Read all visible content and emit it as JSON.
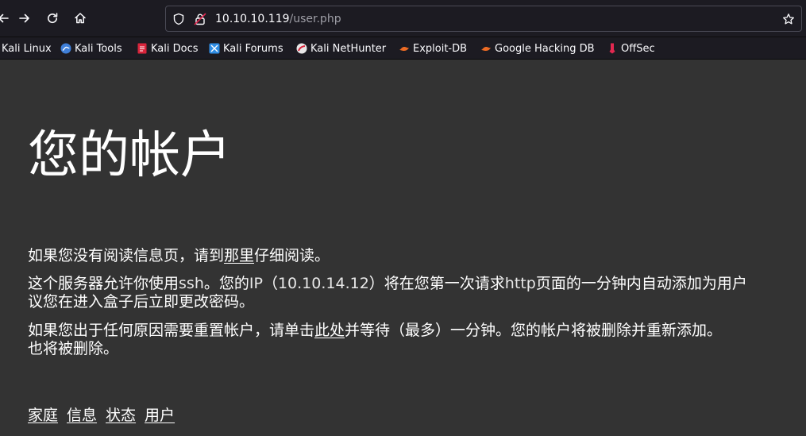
{
  "browser": {
    "url_host": "10.10.10.119",
    "url_path": "/user.php",
    "nav_icons": [
      "back-arrow-icon",
      "forward-arrow-icon",
      "reload-icon",
      "home-icon"
    ],
    "urlbar_icons": [
      "shield-icon",
      "insecure-lock-icon",
      "star-icon"
    ]
  },
  "bookmarks": [
    {
      "label": "Kali Linux",
      "icon": "kali-linux-icon"
    },
    {
      "label": "Kali Tools",
      "icon": "kali-tools-icon"
    },
    {
      "label": "Kali Docs",
      "icon": "kali-docs-icon"
    },
    {
      "label": "Kali Forums",
      "icon": "kali-forums-icon"
    },
    {
      "label": "Kali NetHunter",
      "icon": "kali-nethunter-icon"
    },
    {
      "label": "Exploit-DB",
      "icon": "exploit-db-icon"
    },
    {
      "label": "Google Hacking DB",
      "icon": "google-hacking-db-icon"
    },
    {
      "label": "OffSec",
      "icon": "offsec-icon"
    }
  ],
  "page": {
    "title": "您的帐户",
    "para1": {
      "before": "如果您没有阅读信息页，请到",
      "link": "那里",
      "after": "仔细阅读。"
    },
    "para2": {
      "seg1": "这个服务器允许你使用",
      "ssh": "ssh",
      "seg2": "。您的",
      "ip_label": "IP",
      "seg3": "（",
      "ip": "10.10.14.12",
      "seg4": "）将在您第一次请求",
      "http": "http",
      "seg5": "页面的一分钟内自动添加为用户",
      "line2": "议您在进入盒子后立即更改密码。"
    },
    "para3": {
      "before": "如果您出于任何原因需要重置帐户，请单击",
      "link": "此处",
      "after": "并等待（最多）一分钟。您的帐户将被删除并重新添加。",
      "line2": "也将被删除。"
    },
    "footer_links": [
      "家庭",
      "信息",
      "状态",
      "用户"
    ]
  },
  "colors": {
    "toolbar_bg": "#1c1b22",
    "page_bg": "#333333",
    "text": "#ffffff",
    "url_path": "#9e9ea6",
    "insecure_lock": "#e22850"
  }
}
